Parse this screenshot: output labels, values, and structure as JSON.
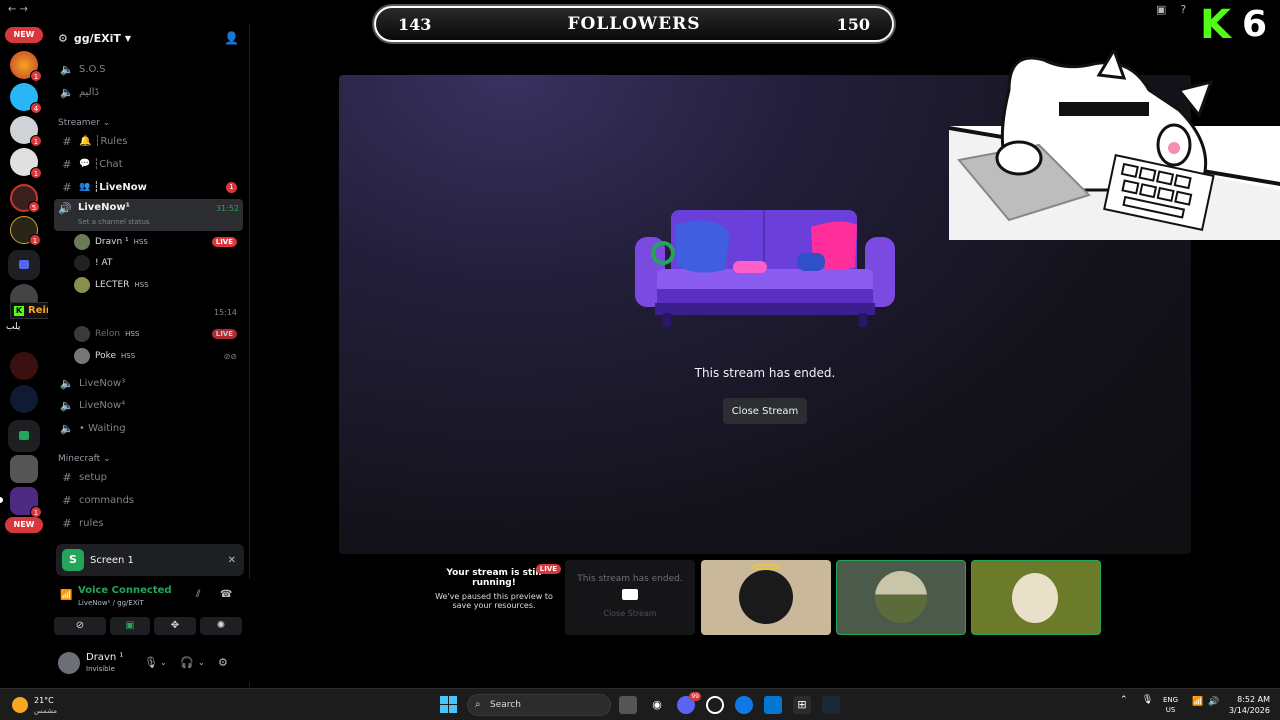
{
  "overlay": {
    "followers_current": "143",
    "followers_label": "FOLLOWERS",
    "followers_goal": "150",
    "kick_letter": "K",
    "kick_count": "6",
    "username_tag": "Reinherz_Klaus",
    "arabic_tag": "يلب"
  },
  "rail": {
    "new_badge_top": "NEW",
    "new_badge_bottom": "NEW",
    "pings": [
      "1",
      "4",
      "1",
      "1",
      "5",
      "1",
      "1"
    ]
  },
  "server": {
    "name": "gg/EXiT"
  },
  "channels": {
    "sos": "S.O.S",
    "arabic_room": "ڈالیم",
    "cat_streamer": "Streamer",
    "rules": "┆Rules",
    "chat": "┆Chat",
    "livenow_text": "┆LiveNow",
    "livenow_text_mention": "1",
    "livenow1": "LiveNow¹",
    "livenow1_timer": "31:52",
    "livenow1_status": "Set a channel status",
    "livenow2_timer": "15:14",
    "livenow3": "LiveNow³",
    "livenow4": "LiveNow⁴",
    "waiting": "• Waiting",
    "cat_minecraft": "Minecraft",
    "setup": "setup",
    "commands": "commands",
    "rules_mc": "rules"
  },
  "voice_users": {
    "u1_name": "Dravn ¹",
    "u1_badge": "HSS",
    "u1_live": "LIVE",
    "u2_name": "! AT",
    "u3_name": "LECTER",
    "u3_badge": "HSS",
    "u4_name": "Relon",
    "u4_badge": "HSS",
    "u4_live": "LIVE",
    "u5_name": "Poke",
    "u5_badge": "HSS"
  },
  "screen_panel": {
    "label": "Screen 1"
  },
  "voice_panel": {
    "status": "Voice Connected",
    "location": "LiveNow¹ / gg/EXiT"
  },
  "user_panel": {
    "name": "Dravn ¹",
    "status": "Invisible"
  },
  "stage": {
    "ended_text": "This stream has ended.",
    "close_button": "Close Stream"
  },
  "preview_strip": {
    "your_stream_title": "Your stream is still running!",
    "your_stream_body": "We've paused this preview to save your resources.",
    "live_badge": "LIVE",
    "tile_ended_text": "This stream has ended.",
    "tile_close_text": "Close Stream"
  },
  "taskbar": {
    "temperature": "21°C",
    "weather_desc": "مشمس",
    "search_placeholder": "Search",
    "discord_badge": "99",
    "lang_line1": "ENG",
    "lang_line2": "US",
    "time": "8:52 AM",
    "date": "3/14/2026"
  },
  "colors": {
    "accent_green": "#23a55a",
    "live_red": "#da373c",
    "kick_green": "#53fc18",
    "stage_purple": "#3a3160"
  }
}
